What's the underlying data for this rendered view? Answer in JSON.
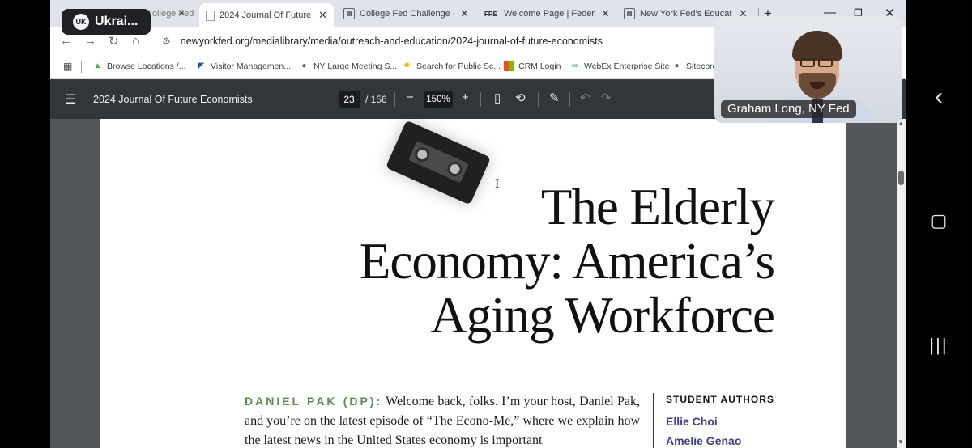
{
  "browser": {
    "tabs": [
      {
        "title": "College Fed Challenge"
      },
      {
        "title": "2024 Journal Of Future Economists"
      },
      {
        "title": "College Fed Challenge - Federal Reserve"
      },
      {
        "title": "Welcome Page | Federal Reserve"
      },
      {
        "title": "New York Fed's Education"
      }
    ],
    "tab3_favicon": "FRE",
    "url": "newyorkfed.org/medialibrary/media/outreach-and-education/2024-journal-of-future-economists",
    "bookmarks": [
      "Browse Locations /...",
      "Visitor Managemen...",
      "NY Large Meeting S...",
      "Search for Public Sc...",
      "CRM Login",
      "WebEx Enterprise Site",
      "Sitecore"
    ]
  },
  "pdf": {
    "title": "2024 Journal Of Future Economists",
    "current_page": "23",
    "total_pages": "/ 156",
    "zoom": "150%",
    "headline": [
      "The Elderly",
      "Economy: America’s",
      "Aging Workforce"
    ],
    "speaker_tag": "DANIEL PAK (DP):",
    "body_text": "Welcome back, folks. I’m your host, Daniel Pak, and you’re on the latest episode of “The Econo-Me,” where we explain how the latest news in the United States economy is important",
    "authors_header": "STUDENT AUTHORS",
    "authors": [
      "Ellie Choi",
      "Amelie Genao"
    ]
  },
  "profile_chip": {
    "initials": "UK",
    "label": "Ukrai..."
  },
  "video_call": {
    "participant_label": "Graham Long, NY Fed"
  },
  "icons": {
    "menu": "hamburger-icon",
    "fit": "fit-page-icon",
    "rotate": "rotate-icon",
    "annotate": "annotate-icon",
    "undo": "undo-icon",
    "redo": "redo-icon"
  },
  "colors": {
    "speaker_green": "#5d8a4e",
    "author_purple": "#3f3f8a",
    "pdf_toolbar": "#323639",
    "pdf_background": "#525659"
  }
}
